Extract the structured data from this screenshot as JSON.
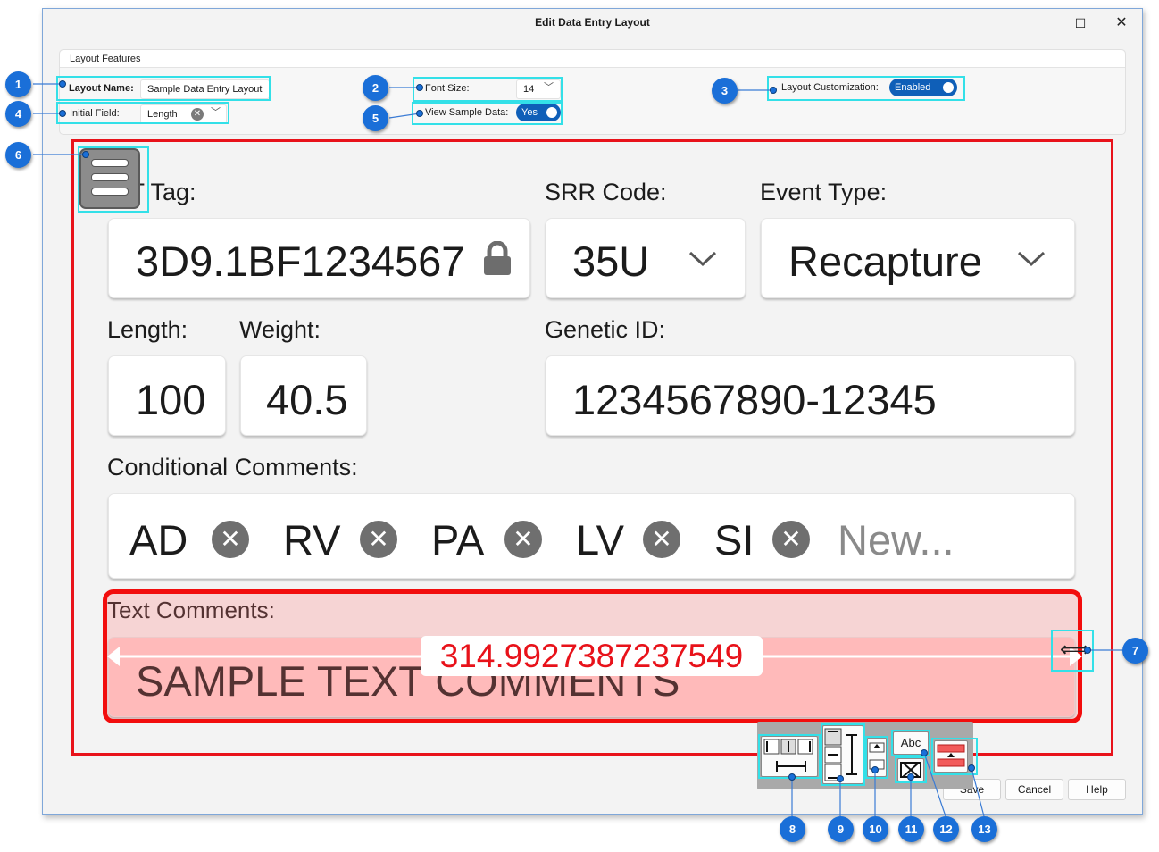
{
  "window": {
    "title": "Edit Data Entry Layout",
    "maximize_glyph": "☐",
    "close_glyph": "✕"
  },
  "layout_features": {
    "title": "Layout Features",
    "layout_name_label": "Layout Name:",
    "layout_name_value": "Sample Data Entry Layout",
    "font_size_label": "Font Size:",
    "font_size_value": "14",
    "layout_customization_label": "Layout Customization:",
    "layout_customization_value": "Enabled",
    "initial_field_label": "Initial Field:",
    "initial_field_value": "Length",
    "view_sample_label": "View Sample Data:",
    "view_sample_value": "Yes"
  },
  "form": {
    "pit_tag_label": "PIT Tag:",
    "pit_tag_value": "3D9.1BF1234567",
    "srr_label": "SRR Code:",
    "srr_value": "35U",
    "event_label": "Event Type:",
    "event_value": "Recapture",
    "length_label": "Length:",
    "length_value": "100",
    "weight_label": "Weight:",
    "weight_value": "40.5",
    "genetic_label": "Genetic ID:",
    "genetic_value": "1234567890-12345",
    "cond_label": "Conditional Comments:",
    "chips": [
      "AD",
      "RV",
      "PA",
      "LV",
      "SI"
    ],
    "chip_placeholder": "New...",
    "text_label": "Text Comments:",
    "text_value": "SAMPLE TEXT COMMENTS",
    "width_readout": "314.9927387237549"
  },
  "toolbar": {
    "label_text": "Abc"
  },
  "footer": {
    "save": "Save",
    "cancel": "Cancel",
    "help": "Help"
  },
  "callouts": [
    "1",
    "2",
    "3",
    "4",
    "5",
    "6",
    "7",
    "8",
    "9",
    "10",
    "11",
    "12",
    "13"
  ],
  "colors": {
    "accent": "#1a6fd8",
    "highlight": "#33e0e8",
    "selection_red": "#f20d0d",
    "toggle_blue": "#0f5fb8"
  },
  "icons": [
    "lock-icon",
    "chevron-down-icon",
    "remove-chip-icon",
    "hamburger-menu-icon",
    "resize-arrows-icon",
    "align-icon",
    "vertical-align-icon",
    "move-field-icon",
    "delete-field-icon",
    "label-icon",
    "field-layout-icon"
  ]
}
